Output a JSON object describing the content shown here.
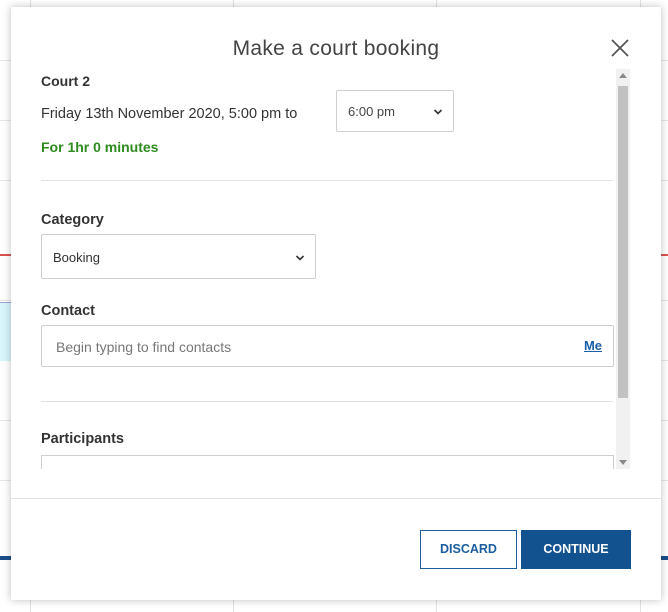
{
  "modal": {
    "title": "Make a court booking"
  },
  "booking": {
    "court": "Court 2",
    "date_text": "Friday 13th November 2020, 5:00 pm to",
    "end_time": "6:00 pm",
    "duration": "For 1hr 0 minutes"
  },
  "category": {
    "label": "Category",
    "value": "Booking"
  },
  "contact": {
    "label": "Contact",
    "placeholder": "Begin typing to find contacts",
    "me_link": "Me"
  },
  "participants": {
    "label": "Participants"
  },
  "footer": {
    "discard_label": "DISCARD",
    "continue_label": "CONTINUE"
  },
  "colors": {
    "accent": "#11528f",
    "duration_green": "#2e8b1e",
    "link_blue": "#1a5ea8"
  },
  "icons": {
    "close": "close-icon",
    "dropdown": "chevron-down-icon"
  }
}
